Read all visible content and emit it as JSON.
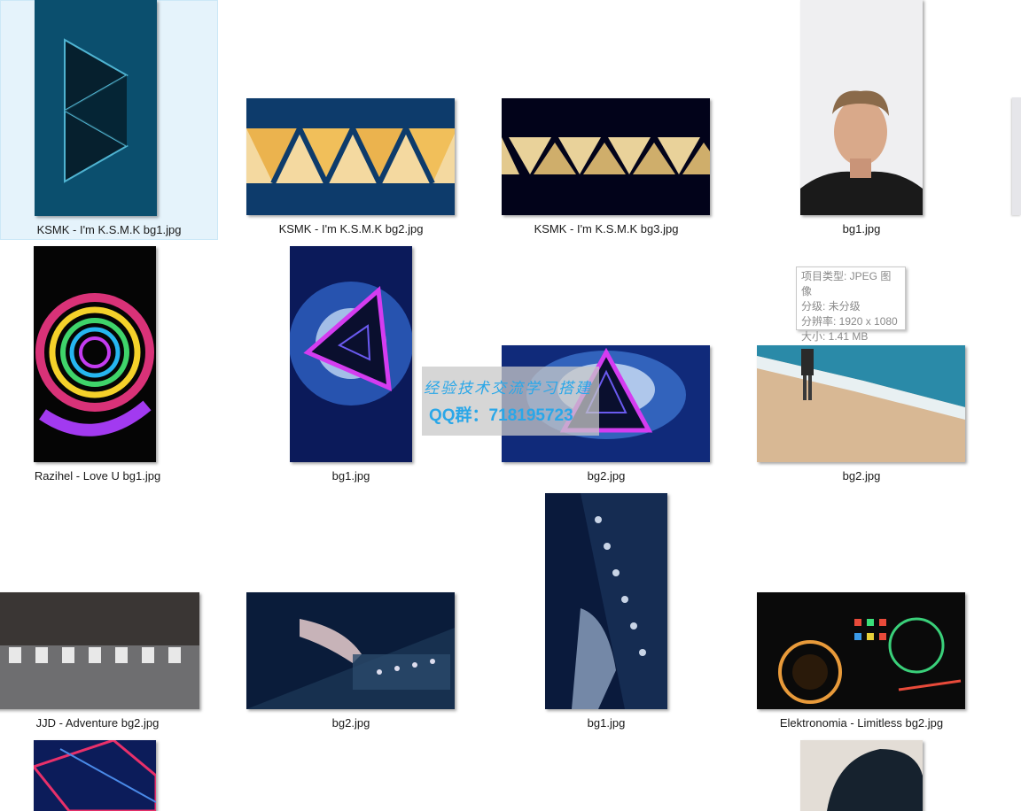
{
  "files": [
    {
      "name": "KSMK - I'm K.S.M.K bg1.jpg"
    },
    {
      "name": "KSMK - I'm K.S.M.K bg2.jpg"
    },
    {
      "name": "KSMK - I'm K.S.M.K bg3.jpg"
    },
    {
      "name": "bg1.jpg"
    },
    {
      "name": "Razihel - Love U bg1.jpg"
    },
    {
      "name": "bg1.jpg"
    },
    {
      "name": "bg2.jpg"
    },
    {
      "name": "bg2.jpg"
    },
    {
      "name": "JJD - Adventure bg2.jpg"
    },
    {
      "name": "bg2.jpg"
    },
    {
      "name": "bg1.jpg"
    },
    {
      "name": "Elektronomia - Limitless bg2.jpg"
    }
  ],
  "tooltip": {
    "type": "项目类型: JPEG 图像",
    "rating": "分级: 未分级",
    "resolution": "分辨率: 1920 x 1080",
    "size": "大小: 1.41 MB"
  },
  "watermark": {
    "line1": "经验技术交流学习搭建",
    "line2": "QQ群：718195723"
  },
  "colors": {
    "selection_bg": "#e5f3fb",
    "watermark_text": "#2aa7e8"
  }
}
